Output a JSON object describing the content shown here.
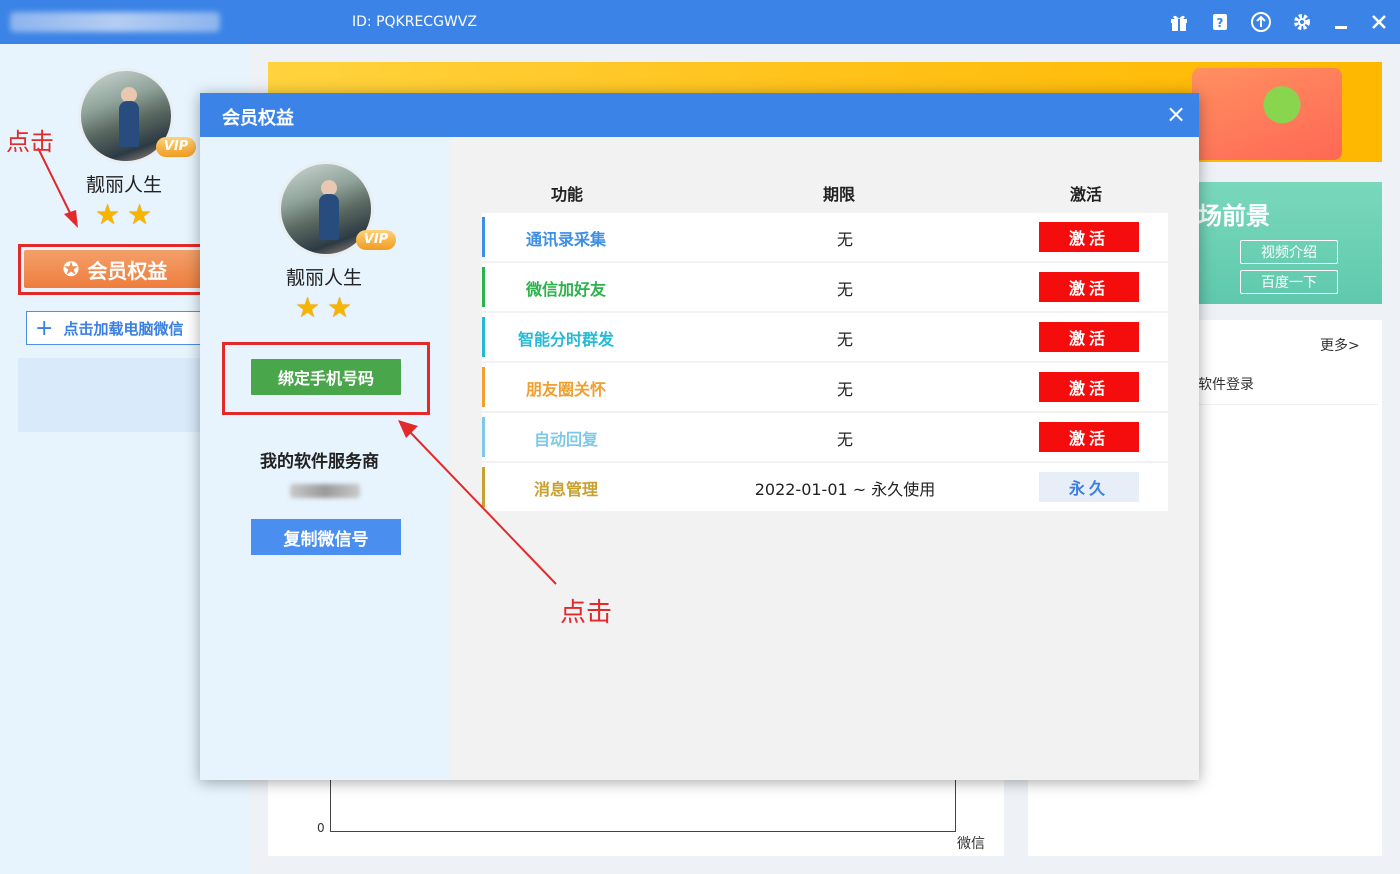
{
  "titlebar": {
    "app_id": "ID: PQKRECGWVZ"
  },
  "sidebar": {
    "username": "靓丽人生",
    "vip": "VIP",
    "member_button": "会员权益",
    "add_wechat": "点击加载电脑微信",
    "annotation": "点击"
  },
  "background": {
    "card_title": "场前景",
    "video_btn": "视频介绍",
    "baidu_btn": "百度一下",
    "more": "更多>",
    "login_item": "软件登录",
    "chart_zero": "0",
    "chart_xlabel": "微信"
  },
  "modal": {
    "title": "会员权益",
    "close": "×",
    "username": "靓丽人生",
    "vip": "VIP",
    "bind_phone": "绑定手机号码",
    "service_title": "我的软件服务商",
    "copy_wechat": "复制微信号",
    "annotation": "点击",
    "table": {
      "headers": [
        "功能",
        "期限",
        "激活"
      ],
      "rows": [
        {
          "feature": "通讯录采集",
          "term": "无",
          "action": "激活",
          "color": "#3b8fe4"
        },
        {
          "feature": "微信加好友",
          "term": "无",
          "action": "激活",
          "color": "#2bb24c"
        },
        {
          "feature": "智能分时群发",
          "term": "无",
          "action": "激活",
          "color": "#26b9d6"
        },
        {
          "feature": "朋友圈关怀",
          "term": "无",
          "action": "激活",
          "color": "#f0a030"
        },
        {
          "feature": "自动回复",
          "term": "无",
          "action": "激活",
          "color": "#7ec9e9"
        },
        {
          "feature": "消息管理",
          "term": "2022-01-01  ~  永久使用",
          "action": "永久",
          "color": "#c8a030"
        }
      ]
    }
  },
  "colors": {
    "accent": "#3b83e6",
    "danger": "#f50c0c",
    "annotation": "#e32a2a"
  }
}
